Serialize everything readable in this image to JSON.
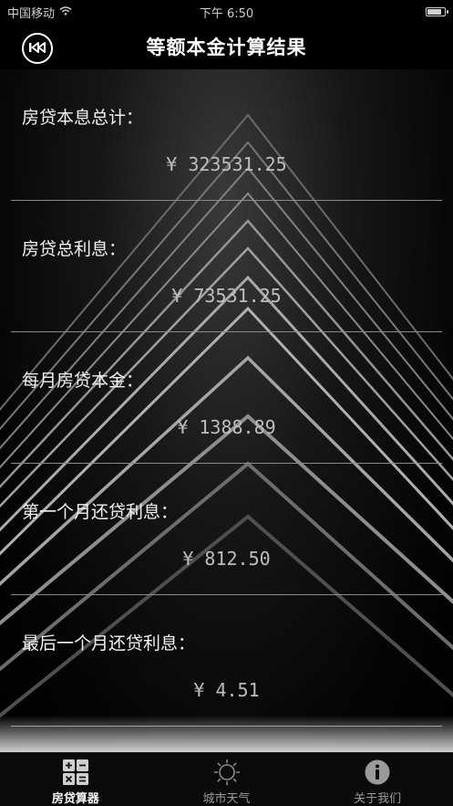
{
  "status_bar": {
    "carrier": "中国移动",
    "time": "下午 6:50"
  },
  "nav": {
    "title": "等额本金计算结果",
    "back_icon": "rewind-circle-icon"
  },
  "results": [
    {
      "label": "房贷本息总计：",
      "value": "¥ 323531.25"
    },
    {
      "label": "房贷总利息：",
      "value": "¥ 73531.25"
    },
    {
      "label": "每月房贷本金：",
      "value": "¥ 1388.89"
    },
    {
      "label": "第一个月还贷利息：",
      "value": "¥ 812.50"
    },
    {
      "label": "最后一个月还贷利息：",
      "value": "¥ 4.51"
    }
  ],
  "tabs": [
    {
      "label": "房贷算器",
      "icon": "calculator-icon",
      "active": true
    },
    {
      "label": "城市天气",
      "icon": "sun-icon",
      "active": false
    },
    {
      "label": "关于我们",
      "icon": "info-icon",
      "active": false
    }
  ],
  "colors": {
    "background": "#000000",
    "text_primary": "#f2f2f2",
    "text_value": "#bdbdbd",
    "divider": "#8a8a8a"
  }
}
